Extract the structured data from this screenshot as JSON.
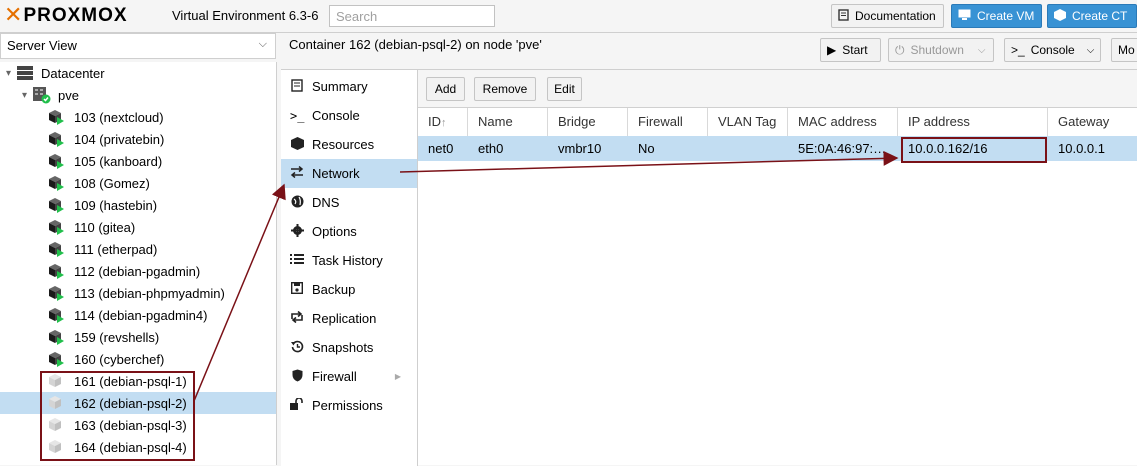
{
  "header": {
    "logo_text": "PROXMOX",
    "version": "Virtual Environment 6.3-6",
    "search_placeholder": "Search",
    "documentation_label": "Documentation",
    "create_vm_label": "Create VM",
    "create_ct_label": "Create CT"
  },
  "sidebar": {
    "view_selector": "Server View",
    "datacenter": "Datacenter",
    "node": "pve",
    "items": [
      {
        "label": "103 (nextcloud)",
        "running": true
      },
      {
        "label": "104 (privatebin)",
        "running": true
      },
      {
        "label": "105 (kanboard)",
        "running": true
      },
      {
        "label": "108 (Gomez)",
        "running": true
      },
      {
        "label": "109 (hastebin)",
        "running": true
      },
      {
        "label": "110 (gitea)",
        "running": true
      },
      {
        "label": "111 (etherpad)",
        "running": true
      },
      {
        "label": "112 (debian-pgadmin)",
        "running": true
      },
      {
        "label": "113 (debian-phpmyadmin)",
        "running": true
      },
      {
        "label": "114 (debian-pgadmin4)",
        "running": true
      },
      {
        "label": "159 (revshells)",
        "running": true
      },
      {
        "label": "160 (cyberchef)",
        "running": true
      },
      {
        "label": "161 (debian-psql-1)",
        "running": false
      },
      {
        "label": "162 (debian-psql-2)",
        "running": false,
        "selected": true
      },
      {
        "label": "163 (debian-psql-3)",
        "running": false
      },
      {
        "label": "164 (debian-psql-4)",
        "running": false
      }
    ]
  },
  "content": {
    "title": "Container 162 (debian-psql-2) on node 'pve'",
    "start_label": "Start",
    "shutdown_label": "Shutdown",
    "console_label": "Console",
    "more_label": "Mo"
  },
  "menu": {
    "items": [
      {
        "label": "Summary",
        "icon": "summary-icon"
      },
      {
        "label": "Console",
        "icon": "console-icon"
      },
      {
        "label": "Resources",
        "icon": "resources-icon"
      },
      {
        "label": "Network",
        "icon": "network-icon",
        "active": true
      },
      {
        "label": "DNS",
        "icon": "globe-icon"
      },
      {
        "label": "Options",
        "icon": "gear-icon"
      },
      {
        "label": "Task History",
        "icon": "list-icon"
      },
      {
        "label": "Backup",
        "icon": "floppy-icon"
      },
      {
        "label": "Replication",
        "icon": "replication-icon"
      },
      {
        "label": "Snapshots",
        "icon": "history-icon"
      },
      {
        "label": "Firewall",
        "icon": "shield-icon"
      },
      {
        "label": "Permissions",
        "icon": "unlock-icon"
      }
    ]
  },
  "network": {
    "add_label": "Add",
    "remove_label": "Remove",
    "edit_label": "Edit",
    "columns": [
      "ID",
      "Name",
      "Bridge",
      "Firewall",
      "VLAN Tag",
      "MAC address",
      "IP address",
      "Gateway"
    ],
    "rows": [
      {
        "id": "net0",
        "name": "eth0",
        "bridge": "vmbr10",
        "firewall": "No",
        "vlan": "",
        "mac": "5E:0A:46:97:…",
        "ip": "10.0.0.162/16",
        "gateway": "10.0.0.1"
      }
    ]
  },
  "colors": {
    "accent": "#3892d4",
    "selection": "#c2ddf2",
    "annotation": "#7a1117",
    "running": "#21bf4b"
  }
}
